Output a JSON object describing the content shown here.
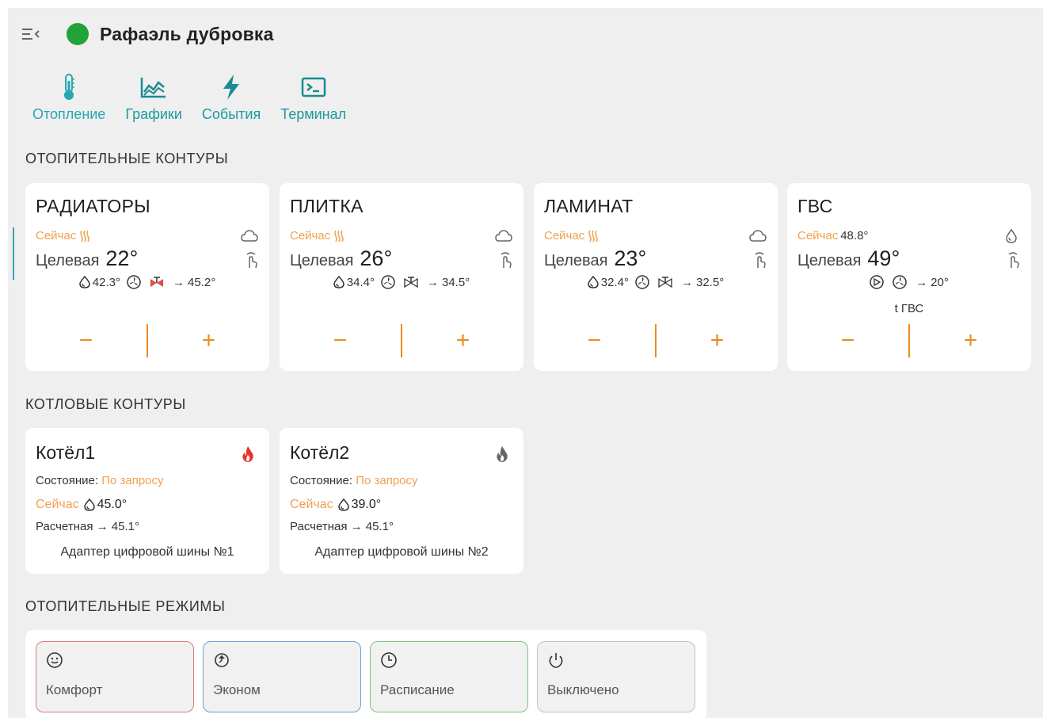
{
  "header": {
    "title": "Рафаэль дубровка",
    "status_color": "#21a33a"
  },
  "tabs": [
    {
      "label": "Отопление",
      "icon": "thermometer-icon",
      "active": true
    },
    {
      "label": "Графики",
      "icon": "chart-icon",
      "active": false
    },
    {
      "label": "События",
      "icon": "lightning-icon",
      "active": false
    },
    {
      "label": "Терминал",
      "icon": "terminal-icon",
      "active": false
    }
  ],
  "sections": {
    "heating_contours": "ОТОПИТЕЛЬНЫЕ КОНТУРЫ",
    "boiler_contours": "КОТЛОВЫЕ КОНТУРЫ",
    "heating_modes": "ОТОПИТЕЛЬНЫЕ РЕЖИМЫ"
  },
  "contours": [
    {
      "name": "РАДИАТОРЫ",
      "now_label": "Сейчас",
      "target_label": "Целевая",
      "target": "22°",
      "sensors": [
        "42.3°",
        "45.2°"
      ],
      "minus": "−",
      "plus": "+"
    },
    {
      "name": "ПЛИТКА",
      "now_label": "Сейчас",
      "target_label": "Целевая",
      "target": "26°",
      "sensors": [
        "34.4°",
        "34.5°"
      ],
      "minus": "−",
      "plus": "+"
    },
    {
      "name": "ЛАМИНАТ",
      "now_label": "Сейчас",
      "target_label": "Целевая",
      "target": "23°",
      "sensors": [
        "32.4°",
        "32.5°"
      ],
      "minus": "−",
      "plus": "+"
    },
    {
      "name": "ГВС",
      "now_label": "Сейчас",
      "now_value": "48.8°",
      "target_label": "Целевая",
      "target": "49°",
      "sensors": [
        "20°"
      ],
      "extra": "t ГВС",
      "minus": "−",
      "plus": "+"
    }
  ],
  "boilers": [
    {
      "name": "Котёл1",
      "state_label": "Состояние:",
      "state_value": "По запросу",
      "now_label": "Сейчас",
      "now_value": "45.0°",
      "calc": "Расчетная → 45.1°",
      "adapter": "Адаптер цифровой шины №1",
      "flame_color": "#e8332a"
    },
    {
      "name": "Котёл2",
      "state_label": "Состояние:",
      "state_value": "По запросу",
      "now_label": "Сейчас",
      "now_value": "39.0°",
      "calc": "Расчетная → 45.1°",
      "adapter": "Адаптер цифровой шины №2",
      "flame_color": "#666666"
    }
  ],
  "modes": [
    {
      "label": "Комфорт",
      "icon": "smile-icon",
      "border": "#e07a7a"
    },
    {
      "label": "Эконом",
      "icon": "eco-icon",
      "border": "#6aa0d8"
    },
    {
      "label": "Расписание",
      "icon": "clock-icon",
      "border": "#7fc27f"
    },
    {
      "label": "Выключено",
      "icon": "power-icon",
      "border": "#c4c4c4"
    }
  ],
  "colors": {
    "accent": "#1a9a9e",
    "orange": "#f08a1c",
    "now_label": "#f0a050",
    "background": "#efefef"
  }
}
